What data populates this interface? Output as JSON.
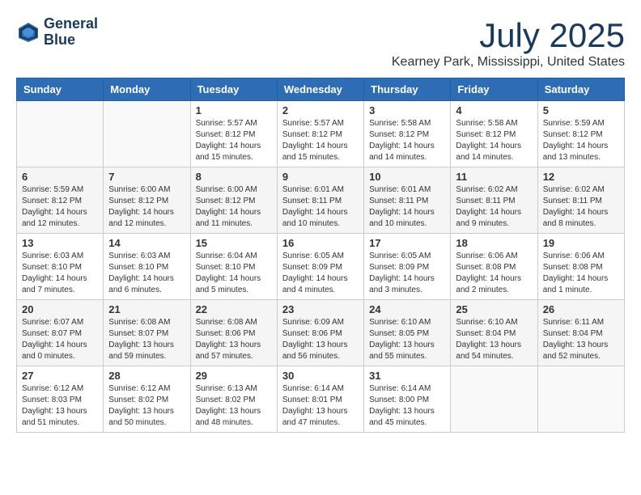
{
  "header": {
    "logo_line1": "General",
    "logo_line2": "Blue",
    "month_title": "July 2025",
    "location": "Kearney Park, Mississippi, United States"
  },
  "days_of_week": [
    "Sunday",
    "Monday",
    "Tuesday",
    "Wednesday",
    "Thursday",
    "Friday",
    "Saturday"
  ],
  "weeks": [
    [
      {
        "day": "",
        "info": ""
      },
      {
        "day": "",
        "info": ""
      },
      {
        "day": "1",
        "info": "Sunrise: 5:57 AM\nSunset: 8:12 PM\nDaylight: 14 hours and 15 minutes."
      },
      {
        "day": "2",
        "info": "Sunrise: 5:57 AM\nSunset: 8:12 PM\nDaylight: 14 hours and 15 minutes."
      },
      {
        "day": "3",
        "info": "Sunrise: 5:58 AM\nSunset: 8:12 PM\nDaylight: 14 hours and 14 minutes."
      },
      {
        "day": "4",
        "info": "Sunrise: 5:58 AM\nSunset: 8:12 PM\nDaylight: 14 hours and 14 minutes."
      },
      {
        "day": "5",
        "info": "Sunrise: 5:59 AM\nSunset: 8:12 PM\nDaylight: 14 hours and 13 minutes."
      }
    ],
    [
      {
        "day": "6",
        "info": "Sunrise: 5:59 AM\nSunset: 8:12 PM\nDaylight: 14 hours and 12 minutes."
      },
      {
        "day": "7",
        "info": "Sunrise: 6:00 AM\nSunset: 8:12 PM\nDaylight: 14 hours and 12 minutes."
      },
      {
        "day": "8",
        "info": "Sunrise: 6:00 AM\nSunset: 8:12 PM\nDaylight: 14 hours and 11 minutes."
      },
      {
        "day": "9",
        "info": "Sunrise: 6:01 AM\nSunset: 8:11 PM\nDaylight: 14 hours and 10 minutes."
      },
      {
        "day": "10",
        "info": "Sunrise: 6:01 AM\nSunset: 8:11 PM\nDaylight: 14 hours and 10 minutes."
      },
      {
        "day": "11",
        "info": "Sunrise: 6:02 AM\nSunset: 8:11 PM\nDaylight: 14 hours and 9 minutes."
      },
      {
        "day": "12",
        "info": "Sunrise: 6:02 AM\nSunset: 8:11 PM\nDaylight: 14 hours and 8 minutes."
      }
    ],
    [
      {
        "day": "13",
        "info": "Sunrise: 6:03 AM\nSunset: 8:10 PM\nDaylight: 14 hours and 7 minutes."
      },
      {
        "day": "14",
        "info": "Sunrise: 6:03 AM\nSunset: 8:10 PM\nDaylight: 14 hours and 6 minutes."
      },
      {
        "day": "15",
        "info": "Sunrise: 6:04 AM\nSunset: 8:10 PM\nDaylight: 14 hours and 5 minutes."
      },
      {
        "day": "16",
        "info": "Sunrise: 6:05 AM\nSunset: 8:09 PM\nDaylight: 14 hours and 4 minutes."
      },
      {
        "day": "17",
        "info": "Sunrise: 6:05 AM\nSunset: 8:09 PM\nDaylight: 14 hours and 3 minutes."
      },
      {
        "day": "18",
        "info": "Sunrise: 6:06 AM\nSunset: 8:08 PM\nDaylight: 14 hours and 2 minutes."
      },
      {
        "day": "19",
        "info": "Sunrise: 6:06 AM\nSunset: 8:08 PM\nDaylight: 14 hours and 1 minute."
      }
    ],
    [
      {
        "day": "20",
        "info": "Sunrise: 6:07 AM\nSunset: 8:07 PM\nDaylight: 14 hours and 0 minutes."
      },
      {
        "day": "21",
        "info": "Sunrise: 6:08 AM\nSunset: 8:07 PM\nDaylight: 13 hours and 59 minutes."
      },
      {
        "day": "22",
        "info": "Sunrise: 6:08 AM\nSunset: 8:06 PM\nDaylight: 13 hours and 57 minutes."
      },
      {
        "day": "23",
        "info": "Sunrise: 6:09 AM\nSunset: 8:06 PM\nDaylight: 13 hours and 56 minutes."
      },
      {
        "day": "24",
        "info": "Sunrise: 6:10 AM\nSunset: 8:05 PM\nDaylight: 13 hours and 55 minutes."
      },
      {
        "day": "25",
        "info": "Sunrise: 6:10 AM\nSunset: 8:04 PM\nDaylight: 13 hours and 54 minutes."
      },
      {
        "day": "26",
        "info": "Sunrise: 6:11 AM\nSunset: 8:04 PM\nDaylight: 13 hours and 52 minutes."
      }
    ],
    [
      {
        "day": "27",
        "info": "Sunrise: 6:12 AM\nSunset: 8:03 PM\nDaylight: 13 hours and 51 minutes."
      },
      {
        "day": "28",
        "info": "Sunrise: 6:12 AM\nSunset: 8:02 PM\nDaylight: 13 hours and 50 minutes."
      },
      {
        "day": "29",
        "info": "Sunrise: 6:13 AM\nSunset: 8:02 PM\nDaylight: 13 hours and 48 minutes."
      },
      {
        "day": "30",
        "info": "Sunrise: 6:14 AM\nSunset: 8:01 PM\nDaylight: 13 hours and 47 minutes."
      },
      {
        "day": "31",
        "info": "Sunrise: 6:14 AM\nSunset: 8:00 PM\nDaylight: 13 hours and 45 minutes."
      },
      {
        "day": "",
        "info": ""
      },
      {
        "day": "",
        "info": ""
      }
    ]
  ]
}
